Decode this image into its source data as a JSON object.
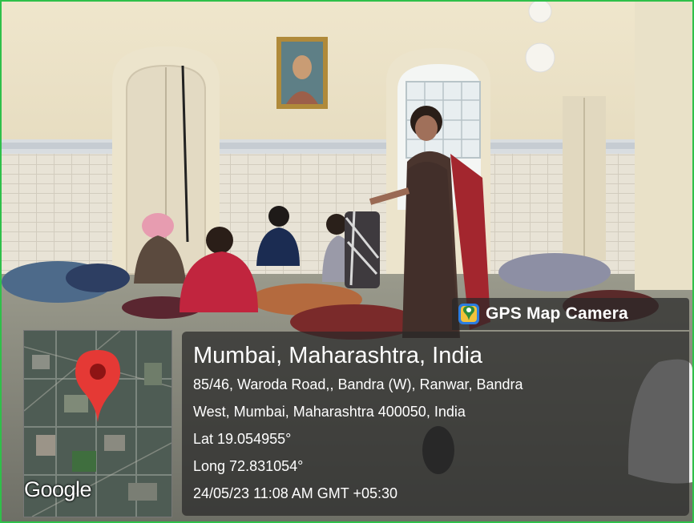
{
  "badge": {
    "label": "GPS Map Camera",
    "icon": "location-pin-icon"
  },
  "location": {
    "title": "Mumbai, Maharashtra, India",
    "address_line1": "85/46, Waroda Road,, Bandra (W), Ranwar, Bandra",
    "address_line2": "West, Mumbai, Maharashtra 400050, India",
    "lat": "Lat 19.054955°",
    "long": "Long 72.831054°",
    "datetime": "24/05/23 11:08 AM GMT +05:30"
  },
  "map": {
    "watermark": "Google",
    "marker_icon": "map-marker-icon"
  },
  "colors": {
    "frame": "#2fc04a",
    "marker": "#e53935",
    "panel": "#282828"
  }
}
